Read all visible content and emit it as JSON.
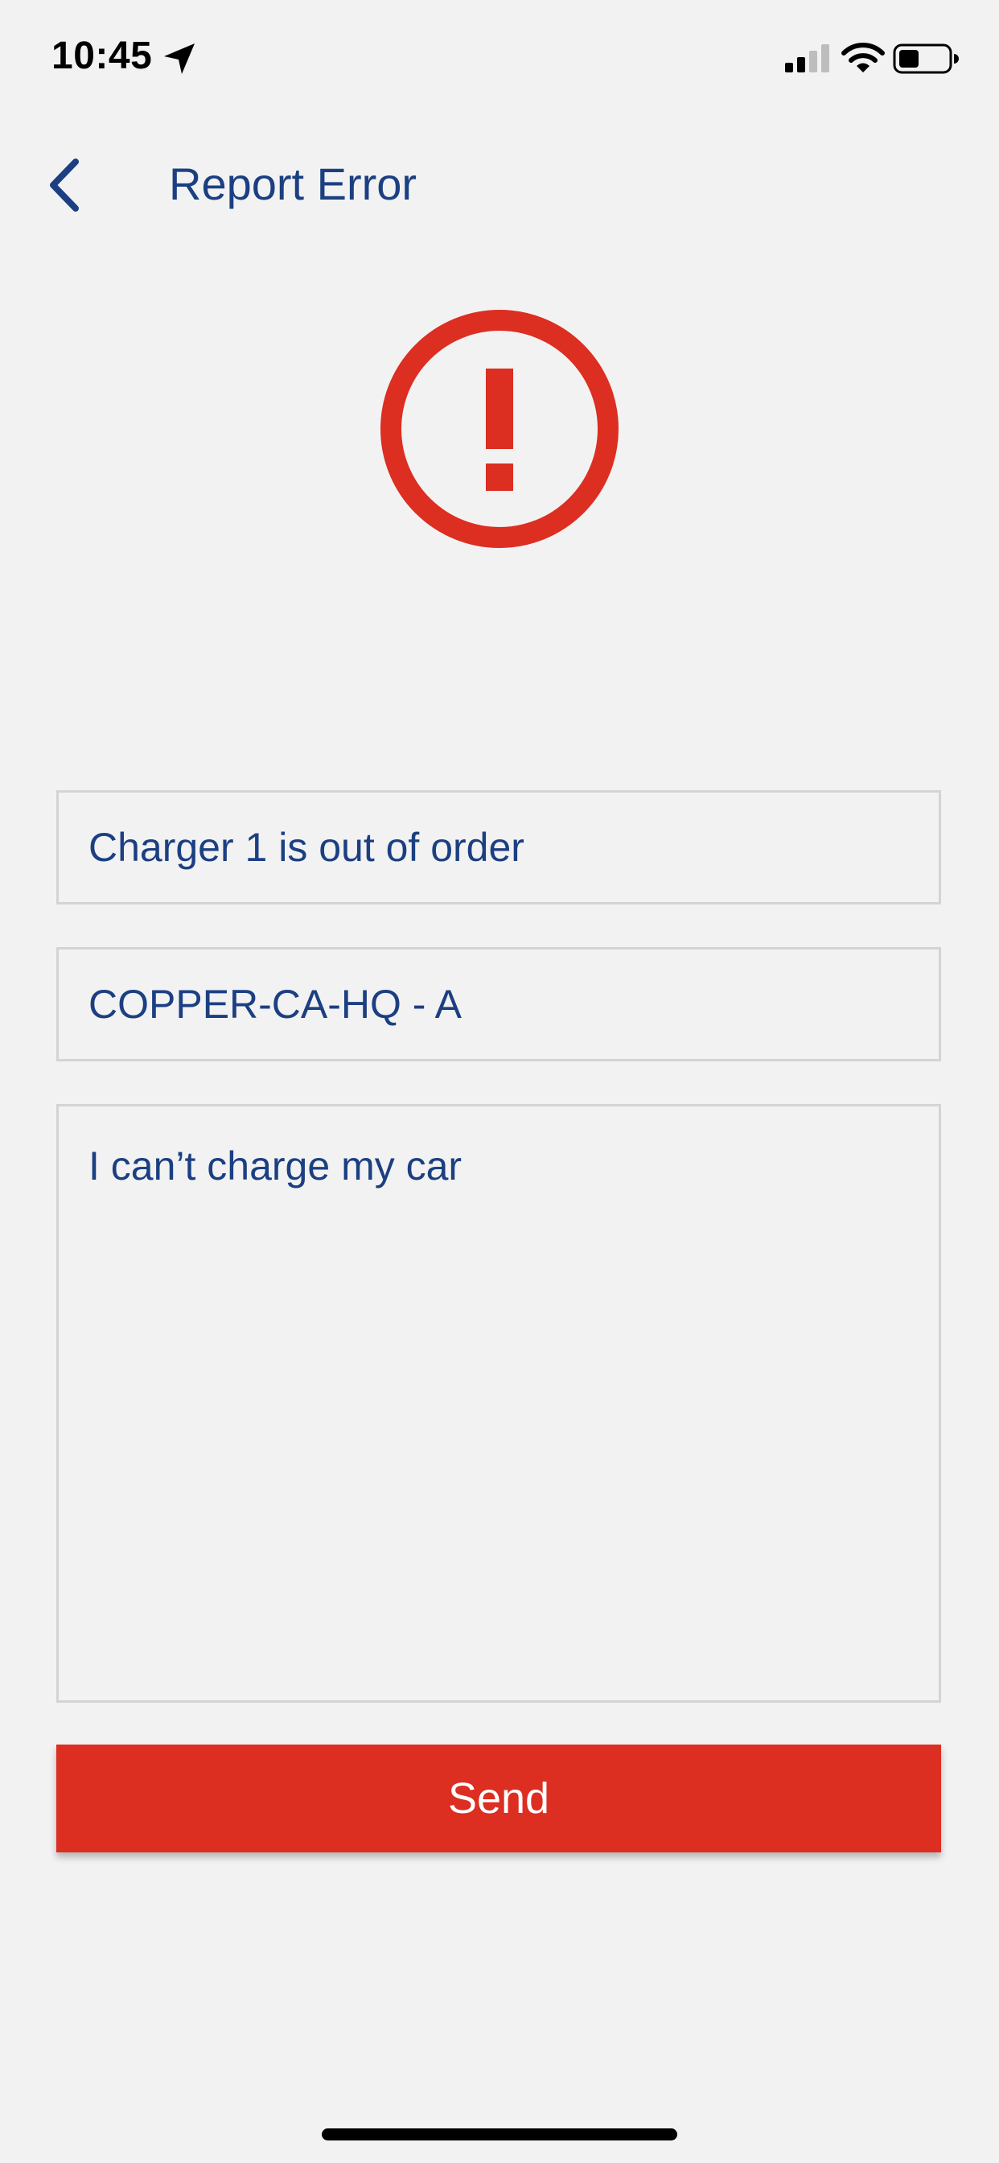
{
  "status_bar": {
    "time": "10:45",
    "icons": [
      "location-arrow-icon",
      "cellular-signal-icon",
      "wifi-icon",
      "battery-icon"
    ]
  },
  "nav": {
    "back_icon": "chevron-left-icon",
    "title": "Report Error"
  },
  "hero": {
    "icon": "exclamation-circle-icon",
    "color": "#dc2e21"
  },
  "form": {
    "subject": "Charger 1 is out of order",
    "location": "COPPER-CA-HQ - A",
    "message": "I can’t charge my car"
  },
  "actions": {
    "send_label": "Send",
    "send_color": "#dc2e21"
  },
  "colors": {
    "background": "#f2f2f2",
    "accent_text": "#1b3f82",
    "border": "#d4d4d4"
  }
}
